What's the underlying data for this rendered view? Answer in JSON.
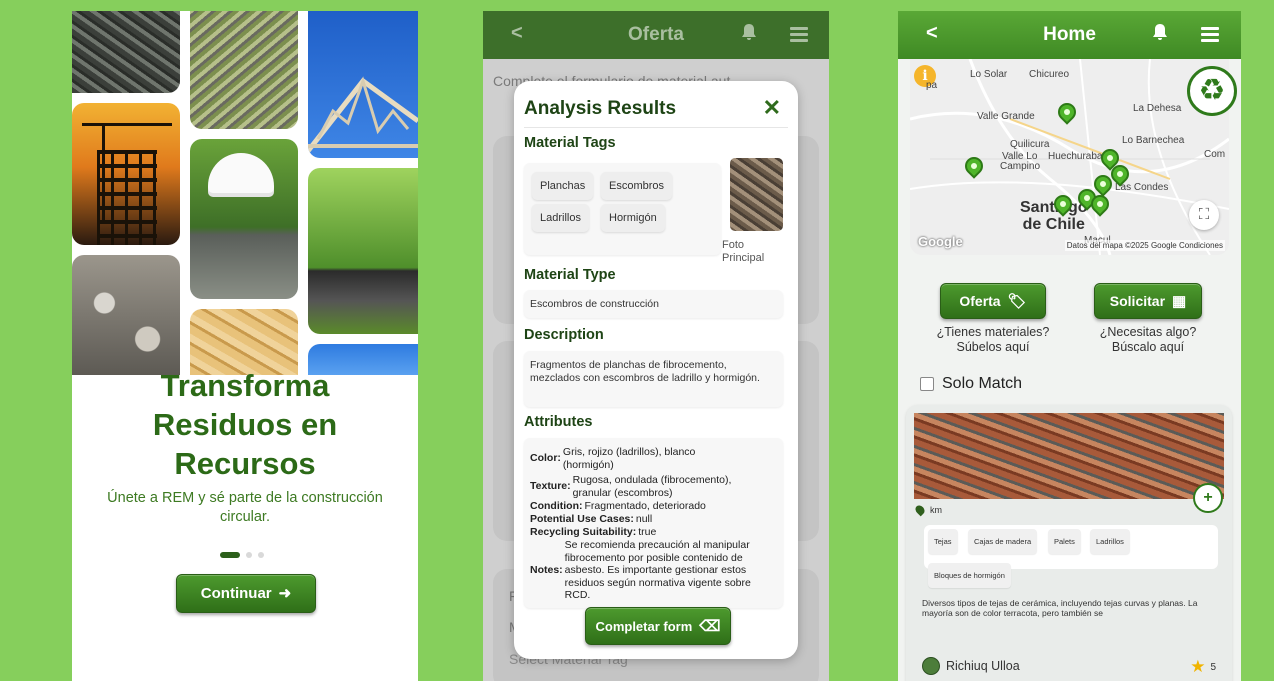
{
  "screen1": {
    "title_line1": "Transforma",
    "title_line2": "Residuos en",
    "title_line3": "Recursos",
    "subtitle": "Únete a REM y sé parte de la construcción circular.",
    "continue_label": "Continuar",
    "continue_icon": "arrow-right-to-bracket-icon"
  },
  "screen2": {
    "header_title": "Oferta",
    "background_text": "Complete el formulario de material aut",
    "background_section_label": "F",
    "background_field_label": "M",
    "background_select_placeholder": "Select Material Tag",
    "modal": {
      "title": "Analysis Results",
      "tags_heading": "Material Tags",
      "tags": [
        "Planchas",
        "Escombros",
        "Ladrillos",
        "Hormigón"
      ],
      "photo_caption": "Foto Principal",
      "type_heading": "Material Type",
      "type_value": "Escombros de construcción",
      "description_heading": "Description",
      "description_value": "Fragmentos de planchas de fibrocemento, mezclados con escombros de ladrillo y hormigón.",
      "attributes_heading": "Attributes",
      "attributes": {
        "color_key": "Color:",
        "color_value": "Gris, rojizo (ladrillos), blanco (hormigón)",
        "texture_key": "Texture:",
        "texture_value": "Rugosa, ondulada (fibrocemento), granular (escombros)",
        "condition_key": "Condition:",
        "condition_value": "Fragmentado, deteriorado",
        "use_key": "Potential Use Cases:",
        "use_value": "null",
        "recycling_key": "Recycling Suitability:",
        "recycling_value": "true",
        "notes_key": "Notes:",
        "notes_value": "Se recomienda precaución al manipular fibrocemento por posible contenido de asbesto. Es importante gestionar estos residuos según normativa vigente sobre RCD."
      },
      "complete_label": "Completar form"
    }
  },
  "screen3": {
    "header_title": "Home",
    "map": {
      "labels": [
        "Lo Solar",
        "Chicureo",
        "pa",
        "Valle Grande",
        "La Dehesa",
        "Quilicura",
        "Lo Barnechea",
        "Valle Lo",
        "Campino",
        "Huechuraba",
        "Com",
        "Las Condes",
        "Macul"
      ],
      "city_line1": "Santiago",
      "city_line2": "de Chile",
      "google_label": "Google",
      "attribution": "Datos del mapa ©2025 Google   Condiciones",
      "pin_count": 8
    },
    "oferta_label": "Oferta",
    "oferta_caption_line1": "¿Tienes materiales?",
    "oferta_caption_line2": "Súbelos aquí",
    "solicitar_label": "Solicitar",
    "solicitar_caption_line1": "¿Necesitas algo?",
    "solicitar_caption_line2": "Búscalo aquí",
    "solo_match_label": "Solo Match",
    "card": {
      "distance": "km",
      "tags": [
        "Tejas",
        "Cajas de madera",
        "Palets",
        "Ladrillos",
        "Bloques de hormigón"
      ],
      "description": "Diversos tipos de tejas de cerámica, incluyendo tejas curvas y planas. La mayoría son de color terracota, pero también se",
      "author": "Richiuq Ulloa",
      "rating": "5"
    }
  },
  "colors": {
    "background": "#86cf5c",
    "brand_green": "#2c6a17",
    "button_green": "#3f8a24",
    "pin_green": "#4fb52a",
    "star": "#f0b400"
  }
}
